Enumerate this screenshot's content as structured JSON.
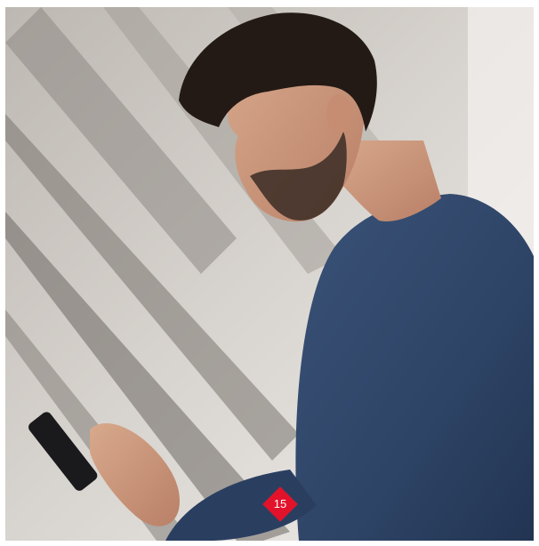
{
  "photo": {
    "subject": "man-looking-at-phone",
    "sweater_color": "#2e4466",
    "background_color": "#d9d6d2"
  },
  "badge": {
    "label": "15",
    "color": "#e3122b",
    "shape": "diamond"
  }
}
